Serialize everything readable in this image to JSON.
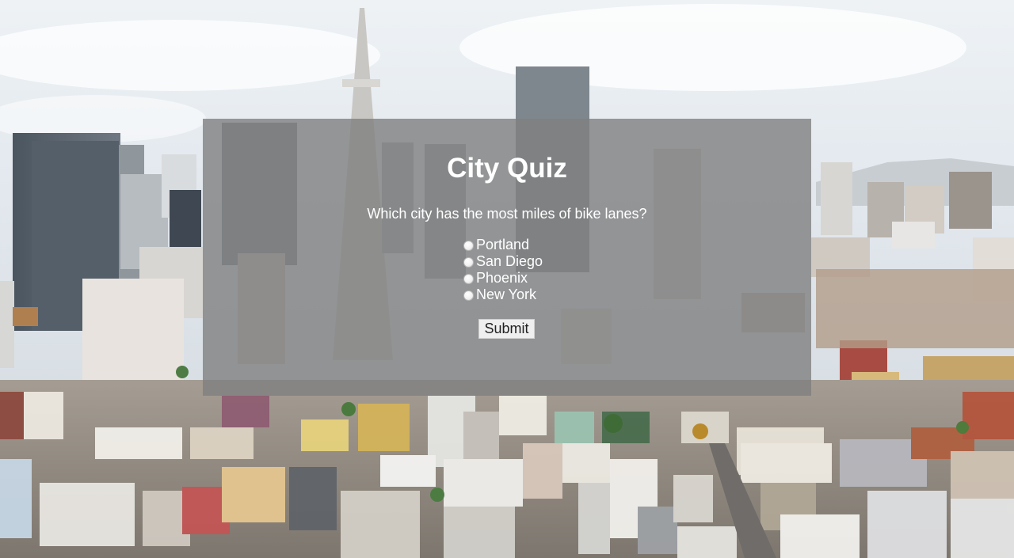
{
  "quiz": {
    "title": "City Quiz",
    "question": "Which city has the most miles of bike lanes?",
    "options": [
      "Portland",
      "San Diego",
      "Phoenix",
      "New York"
    ],
    "submit_label": "Submit"
  },
  "colors": {
    "panel_overlay": "#808080",
    "text": "#ffffff",
    "button_bg": "#efefef"
  },
  "background": {
    "subject": "city-skyline-photo"
  }
}
